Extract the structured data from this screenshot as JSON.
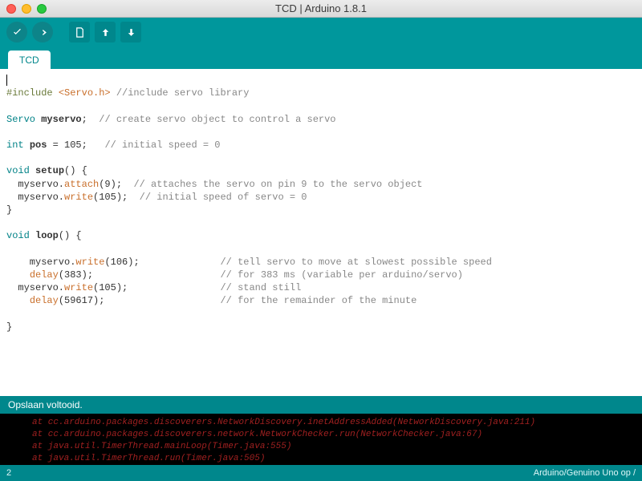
{
  "window": {
    "title": "TCD | Arduino 1.8.1"
  },
  "tab": {
    "name": "TCD"
  },
  "code": {
    "cursorLine": "",
    "l1": {
      "pre": "#include",
      "space": " ",
      "lib": "<Servo.h>",
      "rest": " //include servo library"
    },
    "l3": {
      "type": "Servo",
      "rest1": " ",
      "var": "myservo",
      "rest2": ";  ",
      "comment": "// create servo object to control a servo"
    },
    "l5": {
      "type": "int",
      "rest1": " ",
      "var": "pos",
      "rest2": " = 105;   ",
      "comment": "// initial speed = 0"
    },
    "l7": {
      "type": "void",
      "rest": " ",
      "name": "setup",
      "rest2": "() {"
    },
    "l8": {
      "indent": "  myservo.",
      "func": "attach",
      "args": "(9);  ",
      "comment": "// attaches the servo on pin 9 to the servo object"
    },
    "l9": {
      "indent": "  myservo.",
      "func": "write",
      "args": "(105);  ",
      "comment": "// initial speed of servo = 0"
    },
    "l10": "}",
    "l12": {
      "type": "void",
      "rest": " ",
      "name": "loop",
      "rest2": "() {"
    },
    "l14": {
      "indent": "    myservo.",
      "func": "write",
      "args": "(106);              ",
      "comment": "// tell servo to move at slowest possible speed"
    },
    "l15": {
      "indent": "    ",
      "func": "delay",
      "args": "(383);                      ",
      "comment": "// for 383 ms (variable per arduino/servo)"
    },
    "l16": {
      "indent": "  myservo.",
      "func": "write",
      "args": "(105);                ",
      "comment": "// stand still"
    },
    "l17": {
      "indent": "    ",
      "func": "delay",
      "args": "(59617);                    ",
      "comment": "// for the remainder of the minute"
    },
    "l19": "}"
  },
  "status": {
    "text": "Opslaan voltooid."
  },
  "console": {
    "l1": "at cc.arduino.packages.discoverers.NetworkDiscovery.inetAddressAdded(NetworkDiscovery.java:211)",
    "l2": "at cc.arduino.packages.discoverers.network.NetworkChecker.run(NetworkChecker.java:67)",
    "l3": "at java.util.TimerThread.mainLoop(Timer.java:555)",
    "l4": "at java.util.TimerThread.run(Timer.java:505)"
  },
  "footer": {
    "left": "2",
    "right": "Arduino/Genuino Uno op /"
  }
}
